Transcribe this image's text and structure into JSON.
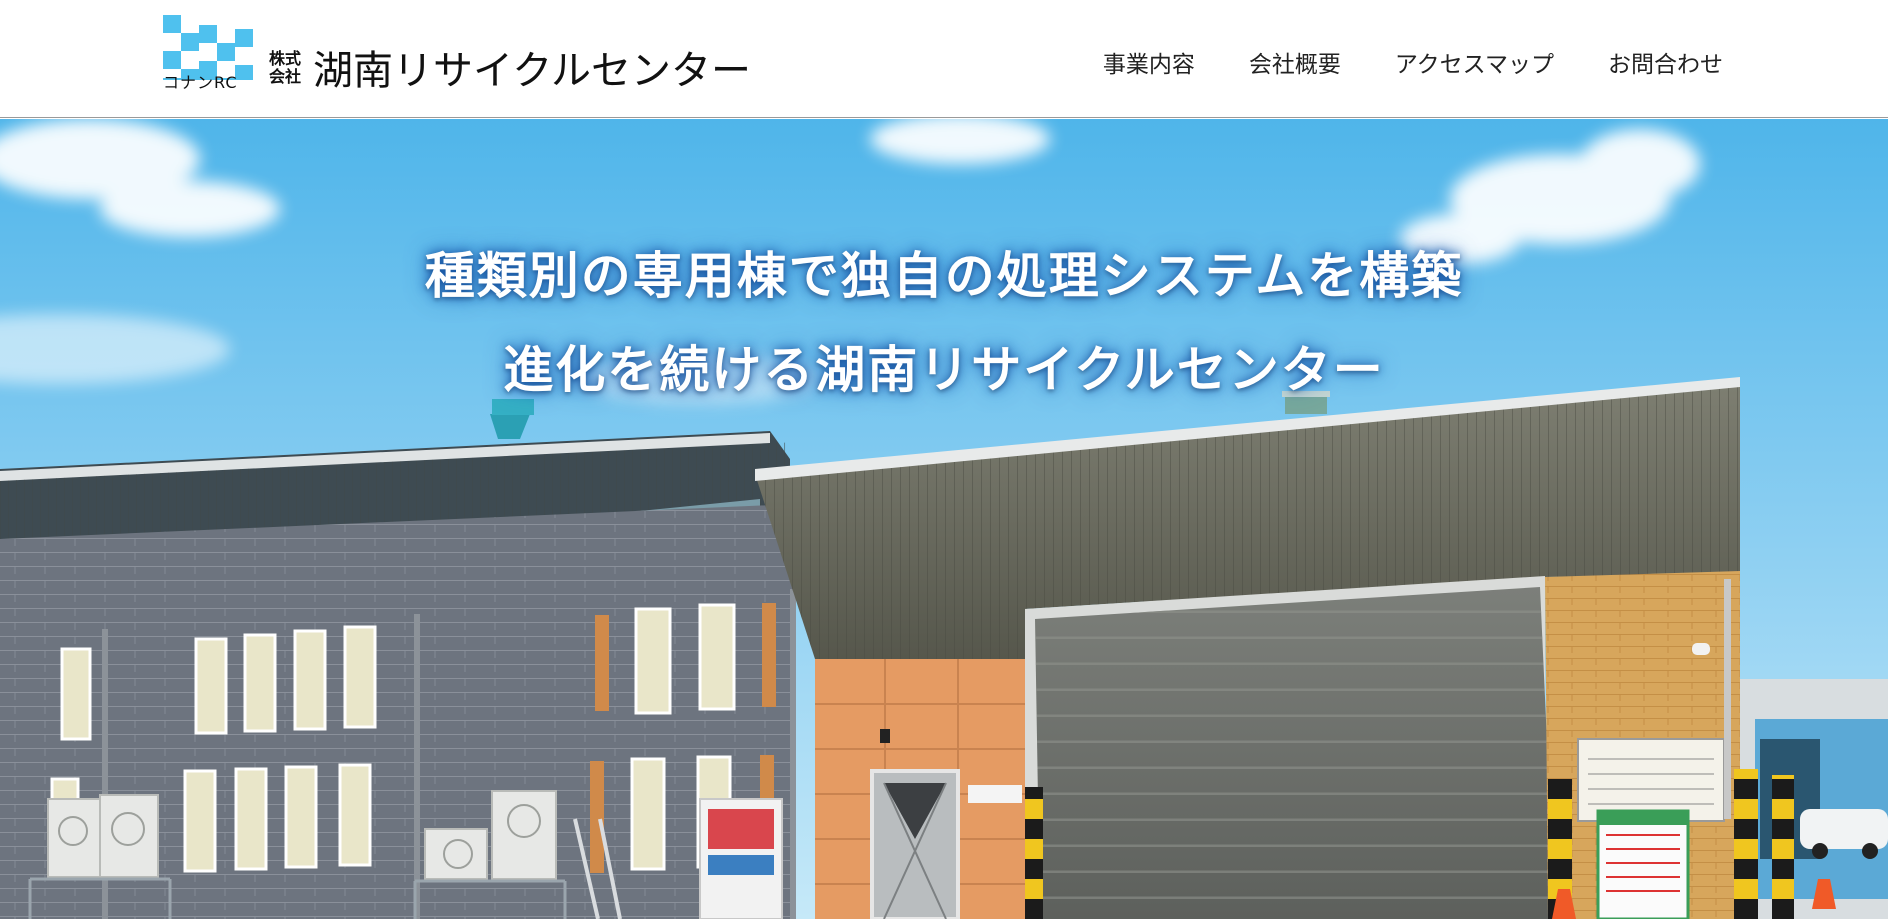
{
  "header": {
    "logo": {
      "roman": "コナンRC",
      "corp_type": "株式会社",
      "name": "湖南リサイクルセンター"
    },
    "nav": [
      {
        "label": "事業内容"
      },
      {
        "label": "会社概要"
      },
      {
        "label": "アクセスマップ"
      },
      {
        "label": "お問合わせ"
      }
    ]
  },
  "hero": {
    "catch_line1": "種類別の専用棟で独自の処理システムを構築",
    "catch_line2": "進化を続ける湖南リサイクルセンター"
  },
  "colors": {
    "sky_top": "#4fb5ea",
    "sky_bottom": "#bfe6f8",
    "logo_checker": "#4fc1ee",
    "wall_gray": "#6f7680",
    "roof": "#6e6f63",
    "panel_orange": "#e39a63",
    "panel_tan": "#d9a85e"
  }
}
